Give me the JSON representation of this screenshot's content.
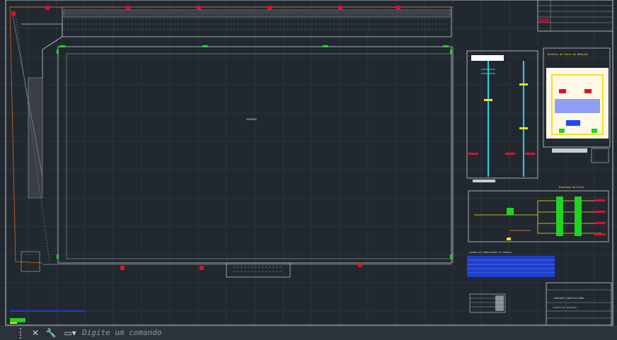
{
  "drawing": {
    "center_label": "GRAMADO",
    "legend_caption": "LEGENDA DE FORNECIMENTO DE ENERGIA",
    "detail_a_title": "Detalhe de Caixa de Medição",
    "detail_b_title": "Diagrama Unifilar",
    "stamp_title": "CONJUNTO HABITACIONAL",
    "stamp_sub": "PLANTA DE SITUAÇÃO"
  },
  "command_line": {
    "placeholder": "Digite um comando",
    "close_icon": "close-icon",
    "customize_icon": "wrench-icon",
    "prompt_icon": "command-prompt-icon"
  },
  "colors": {
    "background": "#212830",
    "lines": "#c8cdd3",
    "accent_red": "#e0102a",
    "accent_green": "#21d421",
    "accent_yellow": "#f4e11a",
    "accent_cyan": "#1fd7e0",
    "accent_orange": "#d86a23",
    "accent_blue": "#1f46ff"
  }
}
